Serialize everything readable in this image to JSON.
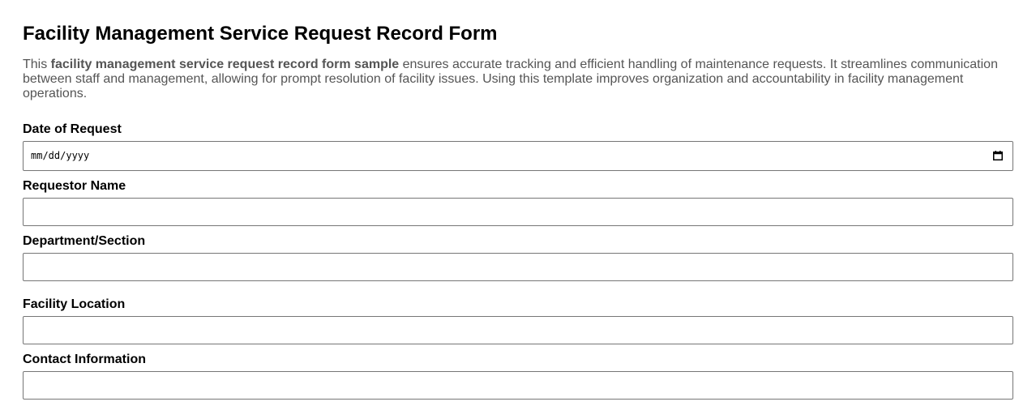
{
  "form": {
    "title": "Facility Management Service Request Record Form",
    "intro": {
      "prefix": "This ",
      "emphasis": "facility management service request record form sample",
      "suffix": " ensures accurate tracking and efficient handling of maintenance requests. It streamlines communication between staff and management, allowing for prompt resolution of facility issues. Using this template improves organization and accountability in facility management operations."
    },
    "fields": {
      "date_of_request": {
        "label": "Date of Request",
        "placeholder": "mm/dd/yyyy",
        "icon": "calendar-icon"
      },
      "requestor_name": {
        "label": "Requestor Name",
        "value": ""
      },
      "department_section": {
        "label": "Department/Section",
        "value": ""
      },
      "facility_location": {
        "label": "Facility Location",
        "value": ""
      },
      "contact_information": {
        "label": "Contact Information",
        "value": ""
      }
    }
  }
}
